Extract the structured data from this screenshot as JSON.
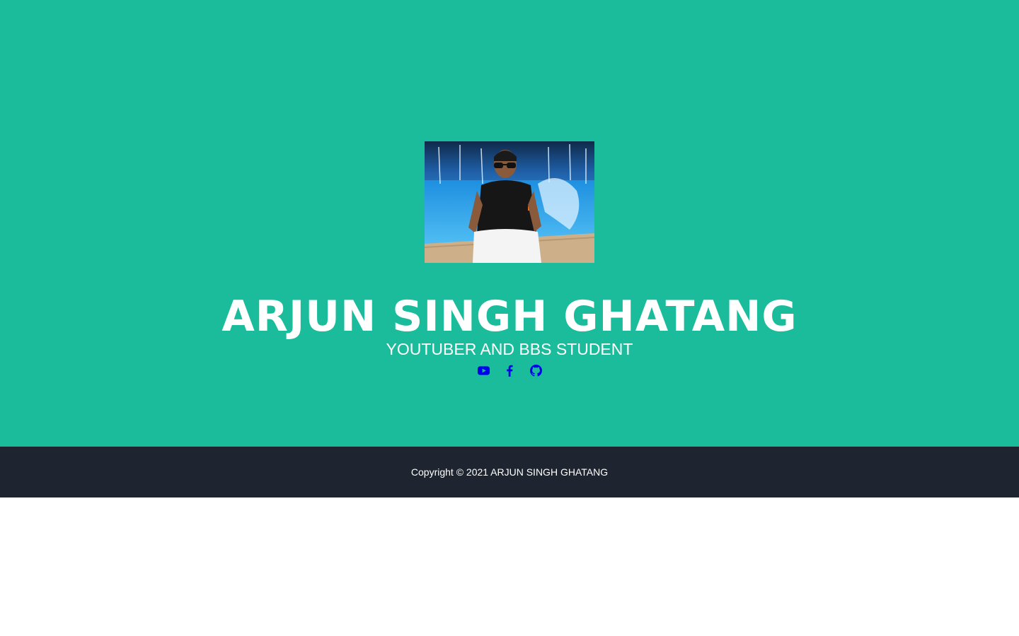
{
  "profile": {
    "name": "ARJUN SINGH GHATANG",
    "tagline": "YOUTUBER AND BBS STUDENT",
    "avatar_alt": "Profile photo"
  },
  "social_links": [
    {
      "name": "youtube",
      "icon": "youtube-icon"
    },
    {
      "name": "facebook",
      "icon": "facebook-icon"
    },
    {
      "name": "github",
      "icon": "github-icon"
    }
  ],
  "footer": {
    "copyright": "Copyright © 2021 ARJUN SINGH GHATANG"
  },
  "colors": {
    "masthead_bg": "#1abc9c",
    "footer_bg": "#1e2530",
    "social_icon": "#0000ee",
    "text": "#ffffff"
  }
}
